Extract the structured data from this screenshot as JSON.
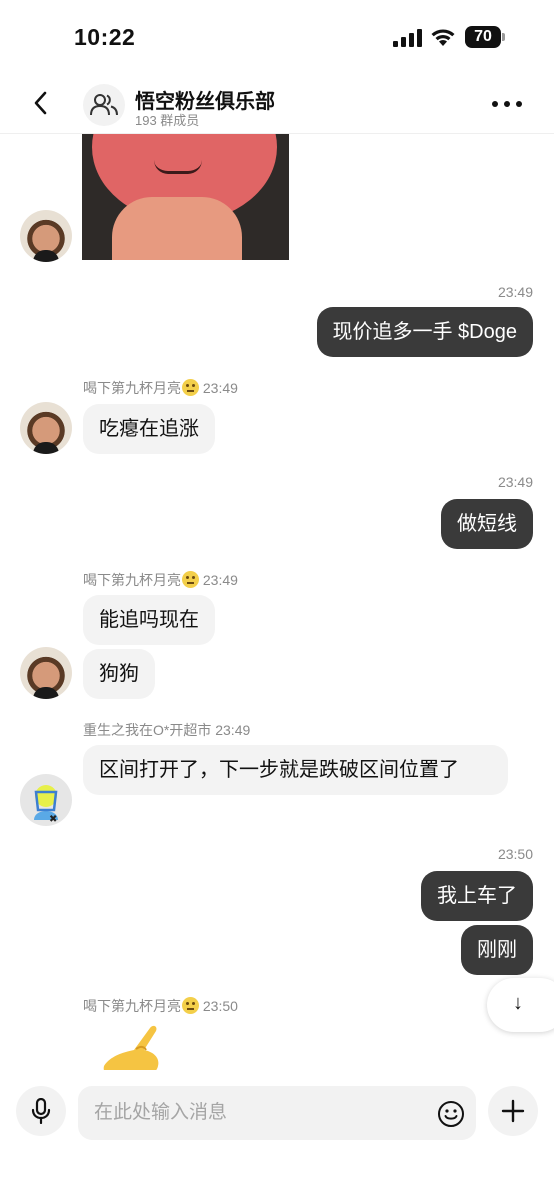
{
  "status_bar": {
    "time": "10:22",
    "battery": "70"
  },
  "header": {
    "title": "悟空粉丝俱乐部",
    "member_count": "193 群成员"
  },
  "messages": [
    {
      "type": "image",
      "direction": "in",
      "sender_avatar": "brad-pitt-avatar"
    },
    {
      "type": "text",
      "direction": "out",
      "time": "23:49",
      "text": "现价追多一手 $Doge"
    },
    {
      "type": "text",
      "direction": "in",
      "sender": "喝下第九杯月亮",
      "sender_emoji": "slightly-smiling-face",
      "time": "23:49",
      "text": "吃瘪在追涨"
    },
    {
      "type": "text",
      "direction": "out",
      "time": "23:49",
      "text": "做短线"
    },
    {
      "type": "text",
      "direction": "in",
      "sender": "喝下第九杯月亮",
      "sender_emoji": "slightly-smiling-face",
      "time": "23:49",
      "texts": [
        "能追吗现在",
        "狗狗"
      ]
    },
    {
      "type": "text",
      "direction": "in",
      "sender": "重生之我在O*开超市",
      "time": "23:49",
      "text": "区间打开了，下一步就是跌破区间位置了"
    },
    {
      "type": "text",
      "direction": "out",
      "time": "23:50",
      "texts": [
        "我上车了",
        "刚刚"
      ]
    },
    {
      "type": "emoji",
      "direction": "in",
      "sender": "喝下第九杯月亮",
      "sender_emoji": "slightly-smiling-face",
      "time": "23:50",
      "emoji": "pinching-hand"
    }
  ],
  "scroll_down": {
    "icon": "arrow-down-icon",
    "glyph": "↓"
  },
  "composer": {
    "placeholder": "在此处输入消息"
  },
  "colors": {
    "outgoing_bubble": "#3a3a3a",
    "incoming_bubble": "#f3f3f3",
    "meta_text": "#8a8a8a"
  }
}
